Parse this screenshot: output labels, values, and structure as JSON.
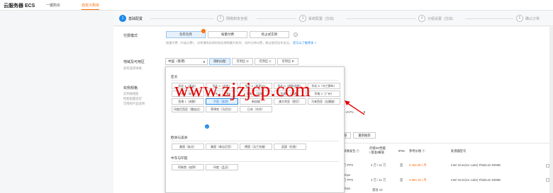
{
  "header": {
    "brand": "云服务器 ECS",
    "tabs": [
      {
        "label": "一键购买"
      },
      {
        "label": "自定义购买"
      }
    ]
  },
  "steps": [
    {
      "num": "1",
      "label": "基础配置",
      "sub": ""
    },
    {
      "num": "2",
      "label": "网络和安全组",
      "sub": ""
    },
    {
      "num": "3",
      "label": "系统配置",
      "sub": "(选填)"
    },
    {
      "num": "4",
      "label": "分组设置",
      "sub": "(选填)"
    },
    {
      "num": "5",
      "label": "确认订单",
      "sub": ""
    }
  ],
  "billing": {
    "label": "付费模式",
    "options": [
      "包年包月",
      "按量付费",
      "抢占式实例"
    ],
    "badge": "!",
    "hint": "按量付费（节省计费）、对将增购实例时前台增购算开机时、实时分钟计费，建议使用包年包月。",
    "hint_link": "您可以了解更多 »"
  },
  "region": {
    "label": "地域及可用区",
    "sub": "如何选择地域",
    "selected": "中国（香港）",
    "zones": [
      "随机分配",
      "可用区 D",
      "可用区 C",
      "可用区 B"
    ]
  },
  "instance": {
    "label": "实例规格",
    "subs": [
      "实例规格族",
      "性能配置选型",
      "可用和产品说明"
    ]
  },
  "dropdown": {
    "groups": [
      {
        "title": "亚太",
        "regions": [
          "华北 1（青岛）",
          "华北 2（北京）",
          "华北 3（张家口）",
          "华北 5（呼和浩特）",
          "华北 6（乌兰察布）",
          "华东 1（杭州）",
          "华东 2（上海）",
          "华南 1（深圳）",
          "华南 2（河源）",
          "华南 3（广州）",
          "西南 1（成都）",
          "中国（香港）",
          "新加坡",
          "澳大利亚（悉尼）",
          "马来西亚（吉隆坡）",
          "印度尼西亚（雅加达）",
          "菲律宾（马尼拉）",
          "日本（东京）"
        ]
      },
      {
        "title": "欧洲与美洲",
        "regions": [
          "美国（硅谷）",
          "美国（弗吉尼亚）",
          "德国（法兰克福）",
          "英国（伦敦）"
        ]
      },
      {
        "title": "中东与印度",
        "regions": [
          "阿联酋（迪拜）",
          "印度（孟买）"
        ]
      }
    ]
  },
  "watermark": "www.zjzjcp.com",
  "table": {
    "filter": "3 vCPU",
    "buttons": [
      "全部",
      "最新推荐"
    ],
    "headers": [
      "内网带宽 ①",
      "内网收发包 ①",
      "存储I/O性能 / 基准/峰值",
      "IPv6",
      "参考价格 ①",
      "处理器型号"
    ],
    "rows": [
      {
        "bw": "Gbps",
        "pps": "万 PPS",
        "io": "2 万 / 11 万",
        "ipv6": "是",
        "price": "¥ 462.06 / 月",
        "cpu": "Intel Xeon(Ice Lake) Platinum 8369B"
      },
      {
        "bw": "Gbps",
        "pps": "万 PPS",
        "io": "4 万 / 11 万",
        "ipv6": "是",
        "price": "¥ 964.15 / 月",
        "cpu": "Intel Xeon(Ice Lake) Platinum 8369B"
      },
      {
        "bw": "",
        "pps": "",
        "io": "基准 10",
        "ipv6": "",
        "price": "",
        "cpu": ""
      }
    ]
  },
  "colors": {
    "accent": "#1e88e5",
    "brand": "#ff6a00",
    "watermark": "#e60000"
  }
}
